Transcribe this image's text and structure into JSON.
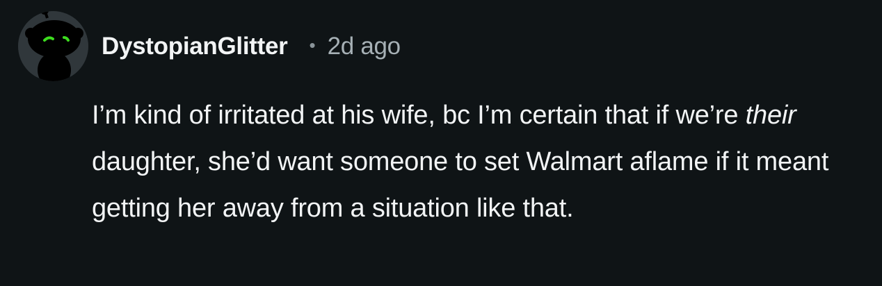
{
  "comment": {
    "author": "DystopianGlitter",
    "separator": "•",
    "timestamp": "2d ago",
    "avatar_icon": "snoo-avatar-icon",
    "body": {
      "part1": "I’m kind of irritated at his wife, bc I’m certain that if we’re ",
      "emphasis": "their",
      "part2": " daughter, she’d want someone to set Walmart aflame if it meant getting her away from a situation like that."
    }
  },
  "colors": {
    "background": "#0f1416",
    "text": "#f2f4f5",
    "meta": "#a6b0b5",
    "avatar_eye": "#3ddc1f"
  }
}
